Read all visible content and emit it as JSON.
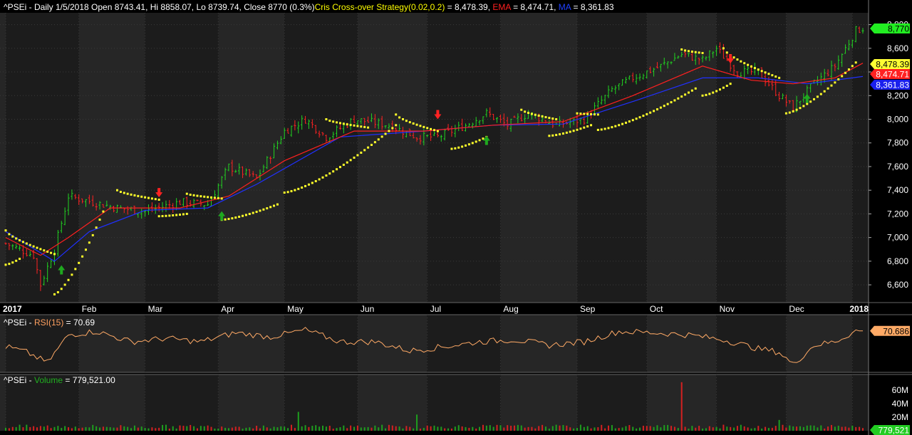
{
  "header": {
    "symbol": "^PSEi",
    "desc": " - Daily 1/5/2018 Open 8743.41, Hi 8858.07, Lo 8739.74, Close 8770 (0.3%)",
    "sar_label": "Cris Cross-over Strategy(0.02,0.2)",
    "sar_value": " = 8,478.39, ",
    "ema_label": "EMA",
    "ema_value": " = 8,474.71, ",
    "ma_label": "MA",
    "ma_value": " = 8,361.83"
  },
  "rsi_header": {
    "symbol": "^PSEi",
    "sep": " - ",
    "label": "RSI(15)",
    "value": " = 70.69"
  },
  "vol_header": {
    "symbol": "^PSEi",
    "sep": " - ",
    "label": "Volume",
    "value": " = 779,521.00"
  },
  "colors": {
    "up": "#21d321",
    "down": "#ff2222",
    "sar": "#ffff2a",
    "ema": "#ff2020",
    "ma": "#2030ff",
    "rsi": "#ffaa66",
    "close_tag": "#22ee22"
  },
  "chart_data": [
    {
      "type": "candlestick",
      "title": "^PSEi - Daily",
      "ylim": [
        6450,
        8900
      ],
      "y_ticks": [
        "8,800",
        "8,600",
        "8,400",
        "8,200",
        "8,000",
        "7,800",
        "7,600",
        "7,400",
        "7,200",
        "7,000",
        "6,800",
        "6,600"
      ],
      "x_labels": [
        "2017",
        "Feb",
        "Mar",
        "Apr",
        "May",
        "Jun",
        "Jul",
        "Aug",
        "Sep",
        "Oct",
        "Nov",
        "Dec",
        "2018"
      ],
      "x_label_index": [
        0,
        21,
        40,
        61,
        80,
        101,
        121,
        142,
        164,
        184,
        204,
        224,
        243
      ],
      "close_points": [
        [
          0,
          6950
        ],
        [
          8,
          6850
        ],
        [
          10,
          6600
        ],
        [
          14,
          6900
        ],
        [
          18,
          7350
        ],
        [
          25,
          7300
        ],
        [
          32,
          7250
        ],
        [
          40,
          7220
        ],
        [
          50,
          7300
        ],
        [
          58,
          7280
        ],
        [
          64,
          7600
        ],
        [
          72,
          7500
        ],
        [
          80,
          7900
        ],
        [
          86,
          8000
        ],
        [
          92,
          7850
        ],
        [
          100,
          8000
        ],
        [
          110,
          7950
        ],
        [
          118,
          7850
        ],
        [
          124,
          7850
        ],
        [
          132,
          7950
        ],
        [
          138,
          8050
        ],
        [
          144,
          7950
        ],
        [
          150,
          8050
        ],
        [
          158,
          7950
        ],
        [
          166,
          8000
        ],
        [
          174,
          8250
        ],
        [
          180,
          8350
        ],
        [
          188,
          8450
        ],
        [
          194,
          8550
        ],
        [
          200,
          8500
        ],
        [
          204,
          8600
        ],
        [
          210,
          8400
        ],
        [
          216,
          8400
        ],
        [
          222,
          8200
        ],
        [
          226,
          8100
        ],
        [
          232,
          8300
        ],
        [
          238,
          8450
        ],
        [
          244,
          8750
        ],
        [
          246,
          8770
        ]
      ],
      "ema_points": [
        [
          0,
          7000
        ],
        [
          10,
          6850
        ],
        [
          18,
          7000
        ],
        [
          30,
          7250
        ],
        [
          50,
          7250
        ],
        [
          64,
          7350
        ],
        [
          80,
          7650
        ],
        [
          100,
          7900
        ],
        [
          120,
          7900
        ],
        [
          140,
          7950
        ],
        [
          160,
          7980
        ],
        [
          180,
          8200
        ],
        [
          200,
          8450
        ],
        [
          214,
          8330
        ],
        [
          226,
          8300
        ],
        [
          238,
          8350
        ],
        [
          246,
          8474.71
        ]
      ],
      "ma_points": [
        [
          0,
          7050
        ],
        [
          14,
          6800
        ],
        [
          24,
          7050
        ],
        [
          40,
          7230
        ],
        [
          58,
          7250
        ],
        [
          72,
          7450
        ],
        [
          96,
          7850
        ],
        [
          120,
          7900
        ],
        [
          140,
          7950
        ],
        [
          160,
          7960
        ],
        [
          180,
          8150
        ],
        [
          200,
          8350
        ],
        [
          216,
          8350
        ],
        [
          230,
          8300
        ],
        [
          246,
          8361.83
        ]
      ],
      "sar_segments": [
        {
          "dir": "above",
          "from": [
            0,
            7060
          ],
          "to": [
            14,
            6860
          ]
        },
        {
          "dir": "below",
          "from": [
            0,
            6770
          ],
          "to": [
            4,
            6820
          ]
        },
        {
          "dir": "below",
          "from": [
            14,
            6520
          ],
          "to": [
            28,
            7220
          ]
        },
        {
          "dir": "above",
          "from": [
            32,
            7400
          ],
          "to": [
            44,
            7320
          ]
        },
        {
          "dir": "below",
          "from": [
            44,
            7180
          ],
          "to": [
            52,
            7200
          ]
        },
        {
          "dir": "above",
          "from": [
            52,
            7370
          ],
          "to": [
            62,
            7330
          ]
        },
        {
          "dir": "below",
          "from": [
            62,
            7150
          ],
          "to": [
            78,
            7280
          ]
        },
        {
          "dir": "below",
          "from": [
            80,
            7380
          ],
          "to": [
            112,
            7950
          ]
        },
        {
          "dir": "above",
          "from": [
            92,
            8000
          ],
          "to": [
            104,
            7930
          ]
        },
        {
          "dir": "above",
          "from": [
            112,
            8040
          ],
          "to": [
            124,
            7900
          ]
        },
        {
          "dir": "below",
          "from": [
            128,
            7750
          ],
          "to": [
            138,
            7850
          ]
        },
        {
          "dir": "above",
          "from": [
            148,
            8080
          ],
          "to": [
            158,
            8000
          ]
        },
        {
          "dir": "below",
          "from": [
            156,
            7860
          ],
          "to": [
            168,
            7950
          ]
        },
        {
          "dir": "above",
          "from": [
            164,
            8050
          ],
          "to": [
            170,
            8040
          ]
        },
        {
          "dir": "below",
          "from": [
            170,
            7910
          ],
          "to": [
            198,
            8260
          ]
        },
        {
          "dir": "above",
          "from": [
            194,
            8590
          ],
          "to": [
            200,
            8560
          ]
        },
        {
          "dir": "below",
          "from": [
            200,
            8200
          ],
          "to": [
            208,
            8300
          ]
        },
        {
          "dir": "above",
          "from": [
            206,
            8600
          ],
          "to": [
            222,
            8350
          ]
        },
        {
          "dir": "below",
          "from": [
            224,
            8050
          ],
          "to": [
            244,
            8480
          ]
        }
      ],
      "signals": [
        {
          "type": "buy",
          "i": 16
        },
        {
          "type": "sell",
          "i": 44
        },
        {
          "type": "buy",
          "i": 62
        },
        {
          "type": "sell",
          "i": 124
        },
        {
          "type": "buy",
          "i": 138
        },
        {
          "type": "sell",
          "i": 208
        },
        {
          "type": "buy",
          "i": 230
        }
      ],
      "price_tags": [
        {
          "label": "8,770",
          "value": 8770,
          "color": "#22ee22"
        },
        {
          "label": "8,478.39",
          "value": 8478.39,
          "color": "#ffff33"
        },
        {
          "label": "8,474.71",
          "value": 8474.71,
          "color": "#ff2222"
        },
        {
          "label": "8,361.83",
          "value": 8361.83,
          "color": "#1a20ee"
        }
      ]
    },
    {
      "type": "line",
      "title": "^PSEi - RSI(15)",
      "ylim": [
        15,
        90
      ],
      "series": [
        {
          "name": "RSI(15)",
          "points": [
            [
              0,
              48
            ],
            [
              6,
              40
            ],
            [
              12,
              25
            ],
            [
              18,
              65
            ],
            [
              26,
              70
            ],
            [
              36,
              55
            ],
            [
              46,
              60
            ],
            [
              56,
              55
            ],
            [
              66,
              68
            ],
            [
              76,
              62
            ],
            [
              86,
              72
            ],
            [
              96,
              55
            ],
            [
              106,
              55
            ],
            [
              116,
              42
            ],
            [
              126,
              48
            ],
            [
              136,
              55
            ],
            [
              146,
              58
            ],
            [
              156,
              50
            ],
            [
              166,
              55
            ],
            [
              176,
              70
            ],
            [
              186,
              68
            ],
            [
              196,
              65
            ],
            [
              206,
              58
            ],
            [
              216,
              45
            ],
            [
              222,
              40
            ],
            [
              226,
              22
            ],
            [
              232,
              50
            ],
            [
              238,
              55
            ],
            [
              244,
              70.69
            ],
            [
              246,
              70.69
            ]
          ]
        }
      ],
      "last_tag": "70.686"
    },
    {
      "type": "bar",
      "title": "^PSEi - Volume",
      "ylim": [
        0,
        75
      ],
      "y_ticks": [
        "60M",
        "40M",
        "20M"
      ],
      "spikes": [
        [
          84,
          28
        ],
        [
          118,
          24
        ],
        [
          194,
          72
        ],
        [
          222,
          16
        ]
      ],
      "last_tag": "779,521"
    }
  ]
}
